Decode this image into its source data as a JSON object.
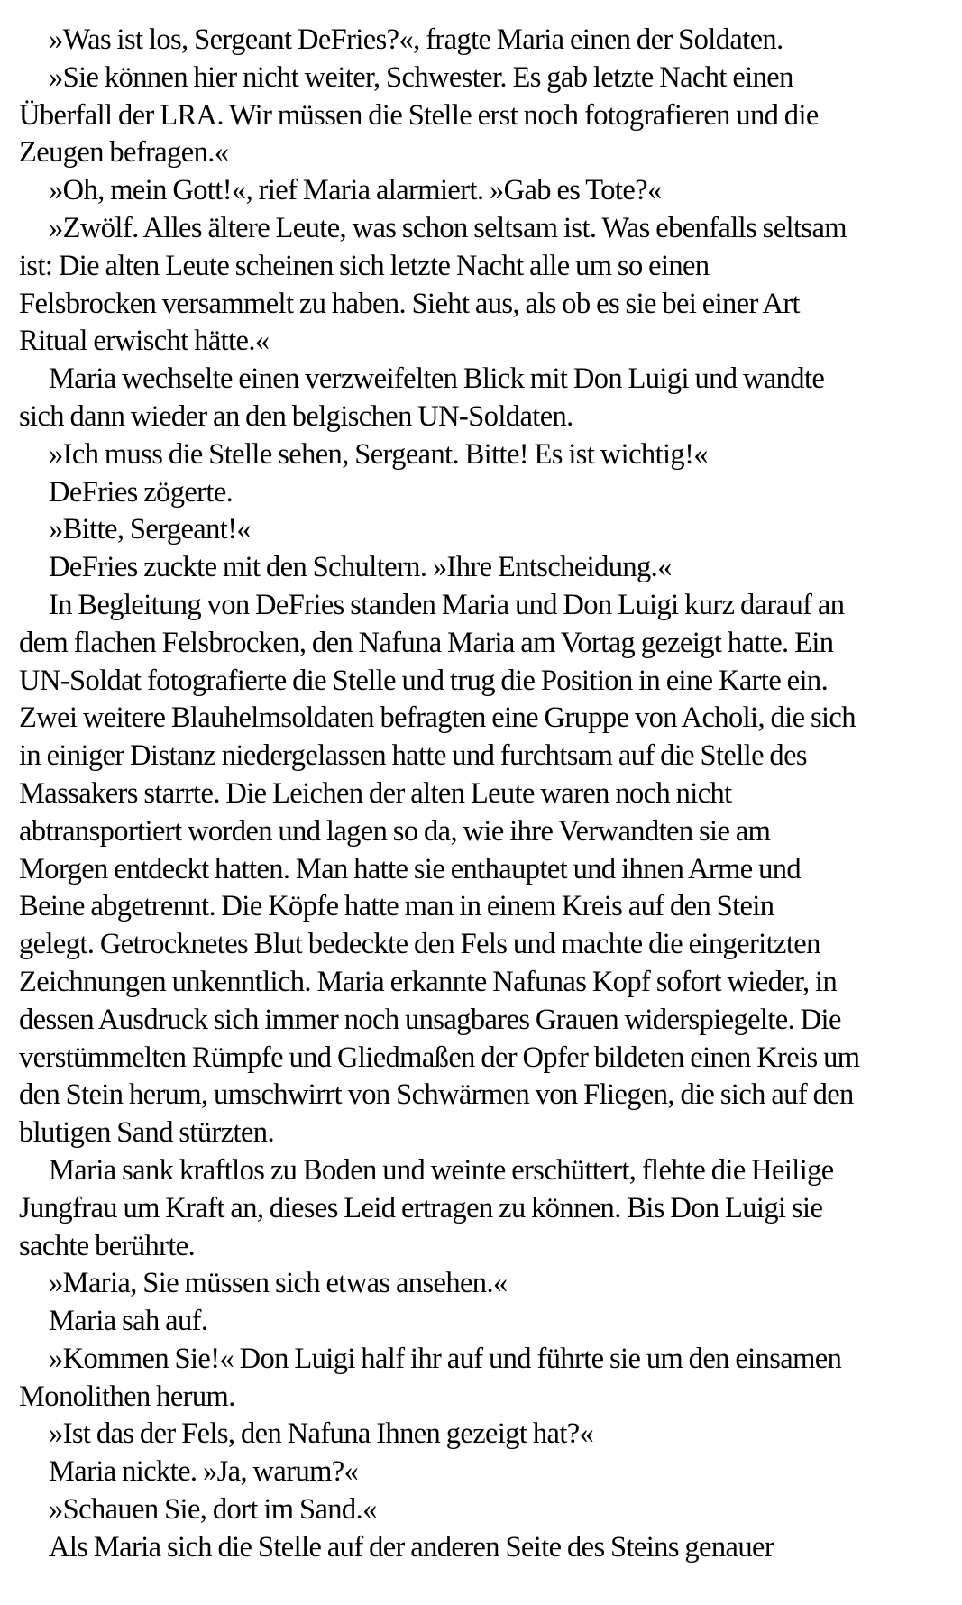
{
  "document": {
    "lines": [
      {
        "text": "»Was ist los, Sergeant DeFries?«, fragte Maria einen der Soldaten.",
        "indent": true
      },
      {
        "text": "»Sie können hier nicht weiter, Schwester. Es gab letzte Nacht einen",
        "indent": true
      },
      {
        "text": "Überfall der LRA. Wir müssen die Stelle erst noch fotografieren und die",
        "indent": false
      },
      {
        "text": "Zeugen befragen.«",
        "indent": false
      },
      {
        "text": "»Oh, mein Gott!«, rief Maria alarmiert. »Gab es Tote?«",
        "indent": true
      },
      {
        "text": "»Zwölf. Alles ältere Leute, was schon seltsam ist. Was ebenfalls seltsam",
        "indent": true
      },
      {
        "text": "ist: Die alten Leute scheinen sich letzte Nacht alle um so einen",
        "indent": false
      },
      {
        "text": "Felsbrocken versammelt zu haben. Sieht aus, als ob es sie bei einer Art",
        "indent": false
      },
      {
        "text": "Ritual erwischt hätte.«",
        "indent": false
      },
      {
        "text": "Maria wechselte einen verzweifelten Blick mit Don Luigi und wandte",
        "indent": true
      },
      {
        "text": "sich dann wieder an den belgischen UN-Soldaten.",
        "indent": false
      },
      {
        "text": "»Ich muss die Stelle sehen, Sergeant. Bitte! Es ist wichtig!«",
        "indent": true
      },
      {
        "text": "DeFries zögerte.",
        "indent": true
      },
      {
        "text": "»Bitte, Sergeant!«",
        "indent": true
      },
      {
        "text": "DeFries zuckte mit den Schultern. »Ihre Entscheidung.«",
        "indent": true
      },
      {
        "text": "In Begleitung von DeFries standen Maria und Don Luigi kurz darauf an",
        "indent": true
      },
      {
        "text": "dem flachen Felsbrocken, den Nafuna Maria am Vortag gezeigt hatte. Ein",
        "indent": false
      },
      {
        "text": "UN-Soldat fotografierte die Stelle und trug die Position in eine Karte ein.",
        "indent": false
      },
      {
        "text": "Zwei weitere Blauhelmsoldaten befragten eine Gruppe von Acholi, die sich",
        "indent": false
      },
      {
        "text": "in einiger Distanz niedergelassen hatte und furchtsam auf die Stelle des",
        "indent": false
      },
      {
        "text": "Massakers starrte. Die Leichen der alten Leute waren noch nicht",
        "indent": false
      },
      {
        "text": "abtransportiert worden und lagen so da, wie ihre Verwandten sie am",
        "indent": false
      },
      {
        "text": "Morgen entdeckt hatten. Man hatte sie enthauptet und ihnen Arme und",
        "indent": false
      },
      {
        "text": "Beine abgetrennt. Die Köpfe hatte man in einem Kreis auf den Stein",
        "indent": false
      },
      {
        "text": "gelegt. Getrocknetes Blut bedeckte den Fels und machte die eingeritzten",
        "indent": false
      },
      {
        "text": "Zeichnungen unkenntlich. Maria erkannte Nafunas Kopf sofort wieder, in",
        "indent": false
      },
      {
        "text": "dessen Ausdruck sich immer noch unsagbares Grauen widerspiegelte. Die",
        "indent": false
      },
      {
        "text": "verstümmelten Rümpfe und Gliedmaßen der Opfer bildeten einen Kreis um",
        "indent": false
      },
      {
        "text": "den Stein herum, umschwirrt von Schwärmen von Fliegen, die sich auf den",
        "indent": false
      },
      {
        "text": "blutigen Sand stürzten.",
        "indent": false
      },
      {
        "text": "Maria sank kraftlos zu Boden und weinte erschüttert, flehte die Heilige",
        "indent": true
      },
      {
        "text": "Jungfrau um Kraft an, dieses Leid ertragen zu können. Bis Don Luigi sie",
        "indent": false
      },
      {
        "text": "sachte berührte.",
        "indent": false
      },
      {
        "text": "»Maria, Sie müssen sich etwas ansehen.«",
        "indent": true
      },
      {
        "text": "Maria sah auf.",
        "indent": true
      },
      {
        "text": "»Kommen Sie!« Don Luigi half ihr auf und führte sie um den einsamen",
        "indent": true
      },
      {
        "text": "Monolithen herum.",
        "indent": false
      },
      {
        "text": "»Ist das der Fels, den Nafuna Ihnen gezeigt hat?«",
        "indent": true
      },
      {
        "text": "Maria nickte. »Ja, warum?«",
        "indent": true
      },
      {
        "text": "»Schauen Sie, dort im Sand.«",
        "indent": true
      },
      {
        "text": "Als Maria sich die Stelle auf der anderen Seite des Steins genauer",
        "indent": true
      }
    ]
  }
}
